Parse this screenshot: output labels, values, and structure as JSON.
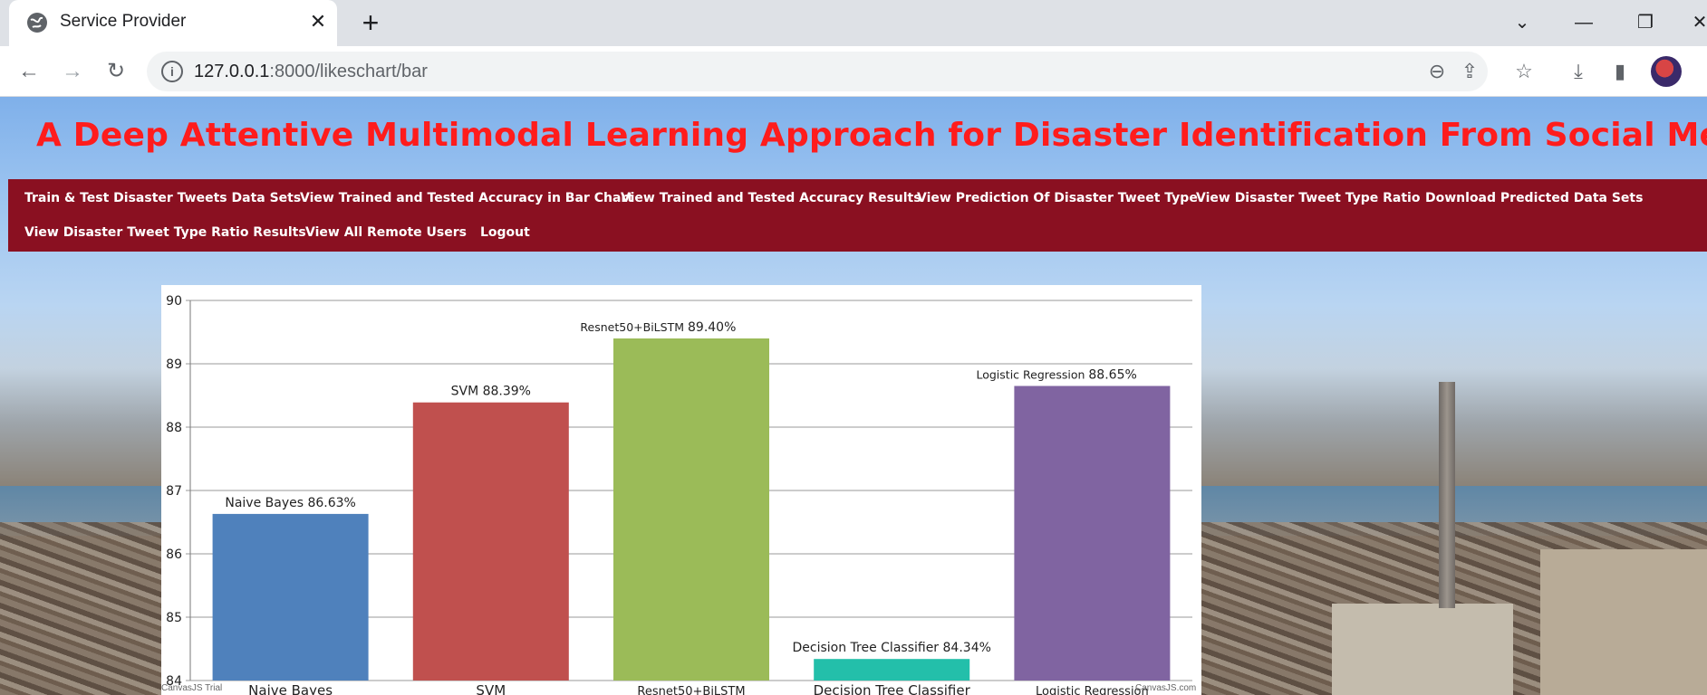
{
  "browser": {
    "tab_title": "Service Provider",
    "tab_close": "✕",
    "new_tab": "+",
    "url_host": "127.0.0.1",
    "url_path": ":8000/likeschart/bar",
    "icons": [
      "globe-icon",
      "back-icon",
      "forward-icon",
      "reload-icon",
      "info-icon",
      "zoom-out-icon",
      "share-icon",
      "star-icon",
      "download-icon",
      "sidepanel-icon",
      "profile-avatar"
    ]
  },
  "page": {
    "title": "A Deep Attentive Multimodal Learning Approach for Disaster Identification From Social Media Posts",
    "title_color": "#ff1c1c",
    "menu_bg": "#8a1021",
    "menu": [
      "Train & Test Disaster Tweets Data Sets",
      "View Trained and Tested Accuracy in Bar Chart",
      "View Trained and Tested Accuracy Results",
      "View Prediction Of Disaster Tweet Type",
      "View Disaster Tweet Type Ratio",
      "Download Predicted Data Sets",
      "View Disaster Tweet Type Ratio Results",
      "View All Remote Users",
      "Logout"
    ]
  },
  "chart_data": {
    "type": "bar",
    "categories": [
      "Naive Bayes",
      "SVM",
      "Resnet50+BiLSTM",
      "Decision Tree Classifier",
      "Logistic Regression"
    ],
    "values": [
      86.63,
      88.39,
      89.4,
      84.34,
      88.65
    ],
    "data_labels": [
      [
        "Naive Bayes 86.63%"
      ],
      [
        "SVM 88.39%"
      ],
      [
        "Resnet50+BiLSTM",
        "89.40%"
      ],
      [
        "Decision Tree Classifier 84.34%"
      ],
      [
        "Logistic Regression",
        "88.65%"
      ]
    ],
    "colors": [
      "#4f81bc",
      "#c0504e",
      "#9bbb58",
      "#23bfaa",
      "#8064a1"
    ],
    "yticks": [
      84,
      85,
      86,
      87,
      88,
      89,
      90
    ],
    "ylim": [
      84,
      90
    ],
    "grid": true,
    "credits": [
      "CanvasJS Trial",
      "CanvasJS.com"
    ]
  }
}
